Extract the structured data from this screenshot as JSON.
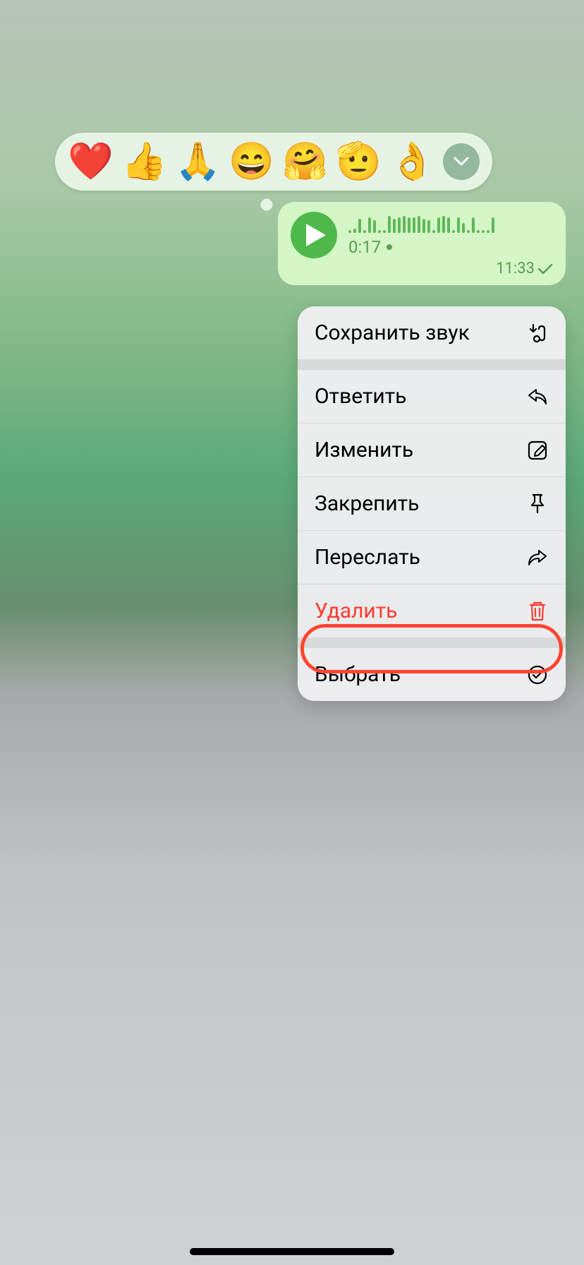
{
  "reactions": {
    "emojis": [
      "❤️",
      "👍",
      "🙏",
      "😄",
      "🤗",
      "🫡",
      "👌"
    ]
  },
  "voice_message": {
    "duration": "0:17",
    "timestamp": "11:33",
    "wave_heights": [
      4,
      6,
      20,
      4,
      22,
      18,
      4,
      4,
      24,
      20,
      22,
      24,
      22,
      22,
      24,
      20,
      18,
      4,
      22,
      24,
      22,
      4,
      22,
      14,
      4,
      22,
      4,
      4,
      4,
      22
    ]
  },
  "menu": {
    "items": [
      {
        "label": "Сохранить звук",
        "icon": "save-sound-icon",
        "danger": false
      },
      {
        "label": "Ответить",
        "icon": "reply-icon",
        "danger": false
      },
      {
        "label": "Изменить",
        "icon": "edit-icon",
        "danger": false
      },
      {
        "label": "Закрепить",
        "icon": "pin-icon",
        "danger": false
      },
      {
        "label": "Переслать",
        "icon": "forward-icon",
        "danger": false
      },
      {
        "label": "Удалить",
        "icon": "trash-icon",
        "danger": true
      },
      {
        "label": "Выбрать",
        "icon": "select-icon",
        "danger": false
      }
    ]
  }
}
